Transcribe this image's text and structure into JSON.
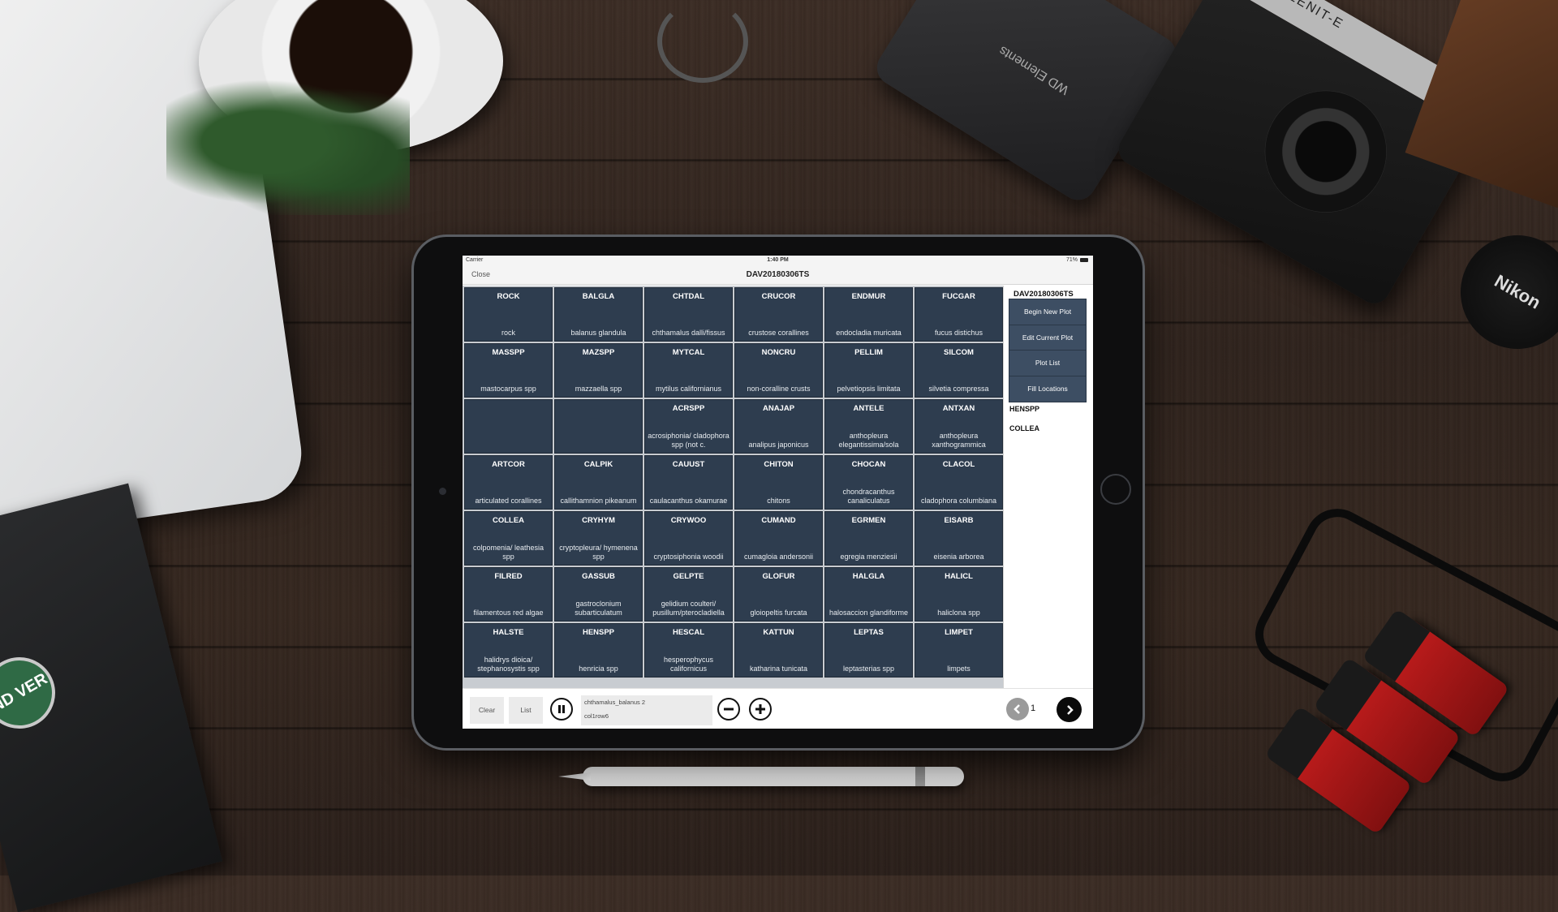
{
  "status_bar": {
    "carrier": "Carrier",
    "time": "1:40 PM",
    "battery": "71%"
  },
  "nav": {
    "close_label": "Close",
    "title": "DAV20180306TS"
  },
  "grid": [
    {
      "code": "ROCK",
      "name": "rock"
    },
    {
      "code": "BALGLA",
      "name": "balanus glandula"
    },
    {
      "code": "CHTDAL",
      "name": "chthamalus dalli/fissus"
    },
    {
      "code": "CRUCOR",
      "name": "crustose corallines"
    },
    {
      "code": "ENDMUR",
      "name": "endocladia muricata"
    },
    {
      "code": "FUCGAR",
      "name": "fucus distichus"
    },
    {
      "code": "MASSPP",
      "name": "mastocarpus spp"
    },
    {
      "code": "MAZSPP",
      "name": "mazzaella spp"
    },
    {
      "code": "MYTCAL",
      "name": "mytilus californianus"
    },
    {
      "code": "NONCRU",
      "name": "non-coralline crusts"
    },
    {
      "code": "PELLIM",
      "name": "pelvetiopsis limitata"
    },
    {
      "code": "SILCOM",
      "name": "silvetia compressa"
    },
    {
      "code": "",
      "name": ""
    },
    {
      "code": "",
      "name": ""
    },
    {
      "code": "ACRSPP",
      "name": "acrosiphonia/ cladophora spp (not c."
    },
    {
      "code": "ANAJAP",
      "name": "analipus japonicus"
    },
    {
      "code": "ANTELE",
      "name": "anthopleura elegantissima/sola"
    },
    {
      "code": "ANTXAN",
      "name": "anthopleura xanthogrammica"
    },
    {
      "code": "ARTCOR",
      "name": "articulated corallines"
    },
    {
      "code": "CALPIK",
      "name": "callithamnion pikeanum"
    },
    {
      "code": "CAUUST",
      "name": "caulacanthus okamurae"
    },
    {
      "code": "CHITON",
      "name": "chitons"
    },
    {
      "code": "CHOCAN",
      "name": "chondracanthus canaliculatus"
    },
    {
      "code": "CLACOL",
      "name": "cladophora columbiana"
    },
    {
      "code": "COLLEA",
      "name": "colpomenia/ leathesia spp"
    },
    {
      "code": "CRYHYM",
      "name": "cryptopleura/ hymenena spp"
    },
    {
      "code": "CRYWOO",
      "name": "cryptosiphonia woodii"
    },
    {
      "code": "CUMAND",
      "name": "cumagloia andersonii"
    },
    {
      "code": "EGRMEN",
      "name": "egregia menziesii"
    },
    {
      "code": "EISARB",
      "name": "eisenia arborea"
    },
    {
      "code": "FILRED",
      "name": "filamentous red algae"
    },
    {
      "code": "GASSUB",
      "name": "gastroclonium subarticulatum"
    },
    {
      "code": "GELPTE",
      "name": "gelidium coulteri/ pusillum/pterocladiella"
    },
    {
      "code": "GLOFUR",
      "name": "gloiopeltis furcata"
    },
    {
      "code": "HALGLA",
      "name": "halosaccion glandiforme"
    },
    {
      "code": "HALICL",
      "name": "haliclona spp"
    },
    {
      "code": "HALSTE",
      "name": "halidrys dioica/ stephanosystis spp"
    },
    {
      "code": "HENSPP",
      "name": "henricia spp"
    },
    {
      "code": "HESCAL",
      "name": "hesperophycus californicus"
    },
    {
      "code": "KATTUN",
      "name": "katharina tunicata"
    },
    {
      "code": "LEPTAS",
      "name": "leptasterias spp"
    },
    {
      "code": "LIMPET",
      "name": "limpets"
    }
  ],
  "sidebar": {
    "plot_title": "DAV20180306TS",
    "buttons": [
      "Begin New Plot",
      "Edit Current Plot",
      "Plot List",
      "Fill Locations"
    ],
    "species": [
      "HENSPP",
      "COLLEA"
    ]
  },
  "toolbar": {
    "clear_label": "Clear",
    "list_label": "List",
    "info_line1": "chthamalus_balanus 2",
    "info_line2": "col1row6",
    "page_number": "1"
  },
  "props": {
    "hdd_label": "WD Elements",
    "camera_label": "ZENIT-E",
    "lenscap_label": "Nikon",
    "badge_label": "ND VER"
  },
  "colors": {
    "cell_bg": "#2e3d4f",
    "button_bg": "#3d4e63"
  }
}
